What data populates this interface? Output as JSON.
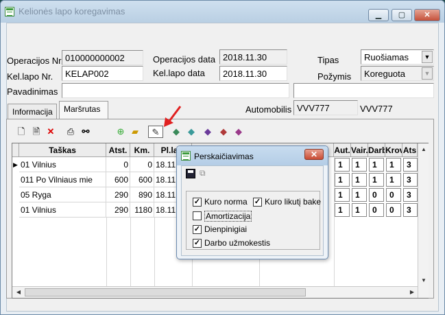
{
  "window": {
    "title": "Kelionės lapo koregavimas",
    "btn_min": "▁",
    "btn_max": "▢",
    "btn_close": "✕"
  },
  "toolbar": {
    "save_icon": "floppy-icon",
    "tree_icon": "tree-icon",
    "copy_icon": "copy-icon",
    "help_icon": "help-icon",
    "help_glyph": "?"
  },
  "form": {
    "operacijos_nr_label": "Operacijos Nr.",
    "operacijos_nr": "010000000002",
    "operacijos_data_label": "Operacijos data",
    "operacijos_data": "2018.11.30",
    "tipas_label": "Tipas",
    "tipas": "Ruošiamas",
    "kel_lapo_nr_label": "Kel.lapo Nr.",
    "kel_lapo_nr": "KELAP002",
    "kel_lapo_data_label": "Kel.lapo data",
    "kel_lapo_data": "2018.11.30",
    "pozymis_label": "Požymis",
    "pozymis": "Koreguota",
    "pavadinimas_label": "Pavadinimas",
    "pavadinimas": "",
    "automobilis_label": "Automobilis",
    "automobilis_code": "VVV777",
    "automobilis_name": "VVV777"
  },
  "tabs": [
    "Informacija",
    "Maršrutas"
  ],
  "grid": {
    "headers": [
      "Taškas",
      "Atst.",
      "Km.",
      "Pl.laik",
      "Aut.",
      "Vair.",
      "Darb",
      "Krov",
      "Ats"
    ],
    "rows": [
      {
        "taskas": "01 Vilnius",
        "atst": "0",
        "km": "0",
        "laik": "18.11.02",
        "aut": "1",
        "vair": "1",
        "darb": "1",
        "krov": "1",
        "ats": "3"
      },
      {
        "taskas": "011 Po Vilniaus mie",
        "atst": "600",
        "km": "600",
        "laik": "18.11.27",
        "aut": "1",
        "vair": "1",
        "darb": "1",
        "krov": "1",
        "ats": "3"
      },
      {
        "taskas": "05 Ryga",
        "atst": "290",
        "km": "890",
        "laik": "18.11.29",
        "aut": "1",
        "vair": "1",
        "darb": "0",
        "krov": "0",
        "ats": "3"
      },
      {
        "taskas": "01 Vilnius",
        "atst": "290",
        "km": "1180",
        "laik": "18.11.30",
        "aut": "1",
        "vair": "1",
        "darb": "0",
        "krov": "0",
        "ats": "3"
      }
    ]
  },
  "dialog": {
    "title": "Perskaičiavimas",
    "close": "✕",
    "options": [
      {
        "label": "Kuro norma",
        "checked": true
      },
      {
        "label": "Kuro likutį bake",
        "checked": true
      },
      {
        "label": "Amortizacija",
        "checked": false
      },
      {
        "label": "Dienpinigiai",
        "checked": true
      },
      {
        "label": "Darbo užmokestis",
        "checked": true
      }
    ]
  },
  "colors": {
    "accent_arrow": "#e02020",
    "title_text": "#7d8fa3"
  }
}
